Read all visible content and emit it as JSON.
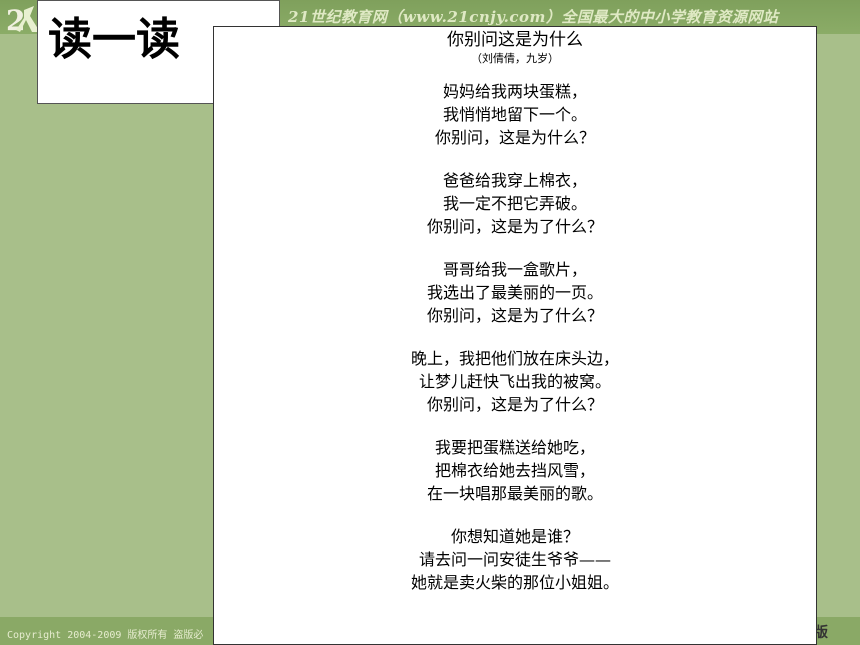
{
  "header": {
    "site_text": "21世纪教育网（www.21cnjy.com）全国最大的中小学教育资源网站"
  },
  "title": "读一读",
  "poem": {
    "title": "你别问这是为什么",
    "author": "（刘倩倩，九岁）",
    "stanzas": [
      {
        "lines": [
          "妈妈给我两块蛋糕，",
          "我悄悄地留下一个。",
          "你别问，这是为什么？"
        ]
      },
      {
        "lines": [
          "爸爸给我穿上棉衣，",
          "我一定不把它弄破。",
          "你别问，这是为了什么？"
        ]
      },
      {
        "lines": [
          "哥哥给我一盒歌片，",
          "我选出了最美丽的一页。",
          "你别问，这是为了什么？"
        ]
      },
      {
        "lines": [
          "晚上，我把他们放在床头边，",
          "让梦儿赶快飞出我的被窝。",
          "你别问，这是为了什么？"
        ]
      },
      {
        "lines": [
          "我要把蛋糕送给她吃，",
          "把棉衣给她去挡风雪，",
          "在一块唱那最美丽的歌。"
        ]
      },
      {
        "lines": [
          "你想知道她是谁？",
          "请去问一问安徒生爷爷——",
          "她就是卖火柴的那位小姐姐。"
        ]
      }
    ]
  },
  "footer": {
    "copyright": "Copyright 2004-2009 版权所有 盗版必",
    "edition": "集版"
  },
  "colors": {
    "background": "#a8bf8a",
    "header": "#7fa05c",
    "footer": "#8aa966"
  }
}
